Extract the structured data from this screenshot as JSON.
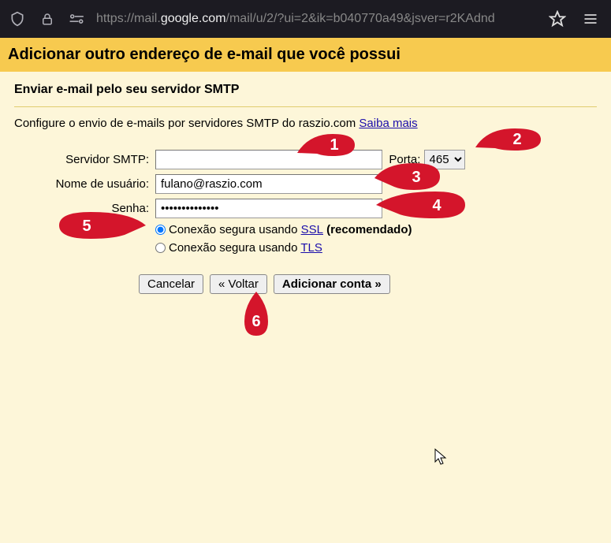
{
  "browser": {
    "url_prefix": "https://mail.",
    "url_domain": "google.com",
    "url_suffix": "/mail/u/2/?ui=2&ik=b040770a49&jsver=r2KAdnd"
  },
  "title": "Adicionar outro endereço de e-mail que você possui",
  "section_title": "Enviar e-mail pelo seu servidor SMTP",
  "instruction_text": "Configure o envio de e-mails por servidores SMTP do raszio.com ",
  "instruction_link": "Saiba mais",
  "labels": {
    "smtp": "Servidor SMTP:",
    "port": "Porta:",
    "user": "Nome de usuário:",
    "password": "Senha:"
  },
  "values": {
    "smtp": "",
    "port_selected": "465",
    "user": "fulano@raszio.com",
    "password": "••••••••••••••"
  },
  "radio": {
    "ssl_prefix": "Conexão segura usando ",
    "ssl_link": "SSL",
    "ssl_suffix": " (recomendado)",
    "tls_prefix": "Conexão segura usando ",
    "tls_link": "TLS"
  },
  "buttons": {
    "cancel": "Cancelar",
    "back": "« Voltar",
    "add": "Adicionar conta »"
  },
  "annotations": {
    "a1": "1",
    "a2": "2",
    "a3": "3",
    "a4": "4",
    "a5": "5",
    "a6": "6"
  }
}
